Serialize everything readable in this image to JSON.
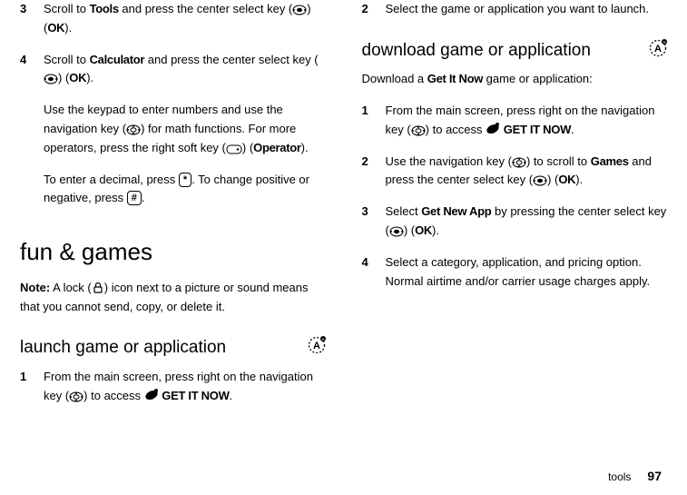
{
  "left": {
    "step3": {
      "num": "3",
      "t1": "Scroll to ",
      "tools": "Tools",
      "t2": " and press the center select key (",
      "t3": ") (",
      "ok": "OK",
      "t4": ")."
    },
    "step4": {
      "num": "4",
      "t1": "Scroll to ",
      "calc": "Calculator",
      "t2": " and press the center select key (",
      "t3": ") (",
      "ok": "OK",
      "t4": ").",
      "p2a": "Use the keypad to enter numbers and use the navigation key (",
      "p2b": ") for math functions. For more operators, press the right soft key (",
      "p2c": ") (",
      "operator": "Operator",
      "p2d": ").",
      "p3a": "To enter a decimal, press ",
      "star": "*",
      "p3b": ". To change positive or negative, press ",
      "hash": "#",
      "p3c": "."
    },
    "fun_heading": "fun & games",
    "note_label": "Note:",
    "note_a": " A lock (",
    "note_b": ") icon next to a picture or sound means that you cannot send, copy, or delete it.",
    "launch_heading": "launch game or application",
    "step1": {
      "num": "1",
      "a": "From the main screen, press right on the navigation key (",
      "b": ") to access ",
      "getitnow": "GET IT NOW",
      "c": "."
    }
  },
  "right": {
    "step2": {
      "num": "2",
      "a": "Select the game or application you want to launch."
    },
    "dl_heading": "download game or application",
    "intro_a": "Download a ",
    "intro_gin": "Get It Now",
    "intro_b": " game or application:",
    "s1": {
      "num": "1",
      "a": "From the main screen, press right on the navigation key (",
      "b": ") to access ",
      "getitnow": "GET IT NOW",
      "c": "."
    },
    "s2": {
      "num": "2",
      "a": "Use the navigation key (",
      "b": ") to scroll to ",
      "games": "Games",
      "c": " and press the center select key (",
      "d": ") (",
      "ok": "OK",
      "e": ")."
    },
    "s3": {
      "num": "3",
      "a": "Select ",
      "gna": "Get New App",
      "b": " by pressing the center select key (",
      "c": ") (",
      "ok": "OK",
      "d": ")."
    },
    "s4": {
      "num": "4",
      "a": "Select a category, application, and pricing option. Normal airtime and/or carrier usage charges apply."
    }
  },
  "footer": {
    "section": "tools",
    "page": "97"
  }
}
